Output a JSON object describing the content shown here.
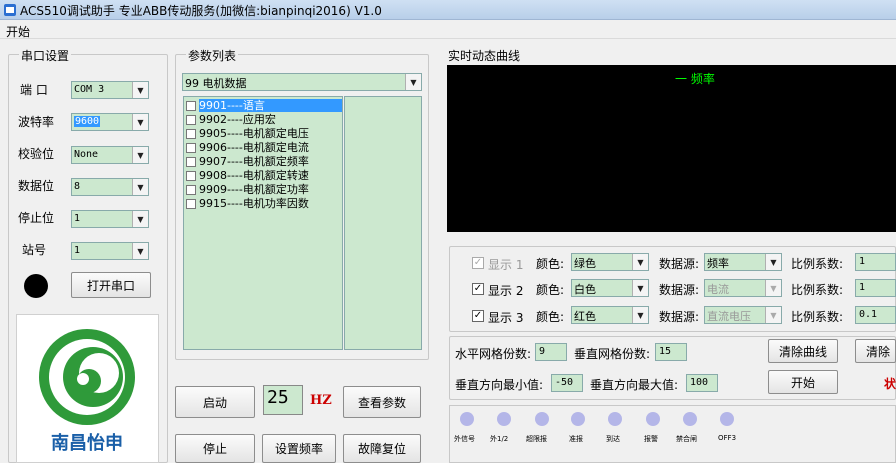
{
  "window": {
    "title": "ACS510调试助手 专业ABB传动服务(加微信:bianpinqi2016) V1.0"
  },
  "menu": {
    "start": "开始"
  },
  "serial": {
    "group_title": "串口设置",
    "port_label": "端  口",
    "port_value": "COM 3",
    "baud_label": "波特率",
    "baud_value": "9600",
    "parity_label": "校验位",
    "parity_value": "None",
    "databits_label": "数据位",
    "databits_value": "8",
    "stopbits_label": "停止位",
    "stopbits_value": "1",
    "station_label": "站号",
    "station_value": "1",
    "open_button": "打开串口",
    "status_color": "#000000"
  },
  "logo": {
    "text": "南昌怡申",
    "brand_color": "#2f9a3a"
  },
  "params": {
    "group_title": "参数列表",
    "selected_group": "99 电机数据",
    "items": [
      {
        "label": "9901----语言",
        "selected": true
      },
      {
        "label": "9902----应用宏"
      },
      {
        "label": "9905----电机额定电压"
      },
      {
        "label": "9906----电机额定电流"
      },
      {
        "label": "9907----电机额定频率"
      },
      {
        "label": "9908----电机额定转速"
      },
      {
        "label": "9909----电机额定功率"
      },
      {
        "label": "9915----电机功率因数"
      }
    ]
  },
  "controls": {
    "start": "启动",
    "freq_value": "25",
    "freq_unit": "HZ",
    "view_params": "查看参数",
    "stop": "停止",
    "set_freq": "设置频率",
    "fault_reset": "故障复位"
  },
  "curve": {
    "group_title": "实时动态曲线",
    "legend": "一 频率",
    "legend_color": "#00ff00",
    "plot_background": "#000000"
  },
  "traces": {
    "color_label": "颜色:",
    "source_label": "数据源:",
    "scale_label": "比例系数:",
    "rows": [
      {
        "show": "显示 1",
        "checked": true,
        "enabled": false,
        "color": "绿色",
        "source": "频率",
        "source_enabled": true,
        "scale": "1"
      },
      {
        "show": "显示 2",
        "checked": true,
        "enabled": true,
        "color": "白色",
        "source": "电流",
        "source_enabled": false,
        "scale": "1"
      },
      {
        "show": "显示 3",
        "checked": true,
        "enabled": true,
        "color": "红色",
        "source": "直流电压",
        "source_enabled": false,
        "scale": "0.1"
      }
    ]
  },
  "grid": {
    "h_label": "水平网格份数:",
    "h_value": "9",
    "v_label": "垂直网格份数:",
    "v_value": "15",
    "vmin_label": "垂直方向最小值:",
    "vmin_value": "-50",
    "vmax_label": "垂直方向最大值:",
    "vmax_value": "100",
    "clear_curve": "清除曲线",
    "clear_cut": "清除",
    "start": "开始",
    "red_text": "状",
    "red_color": "#cc0000"
  },
  "leds": {
    "color_off": "#b4b6e8",
    "labels": [
      "外信号",
      "外1/2",
      "超限报",
      "准报",
      "到达",
      "报警",
      "禁合闸",
      "OFF3"
    ]
  }
}
